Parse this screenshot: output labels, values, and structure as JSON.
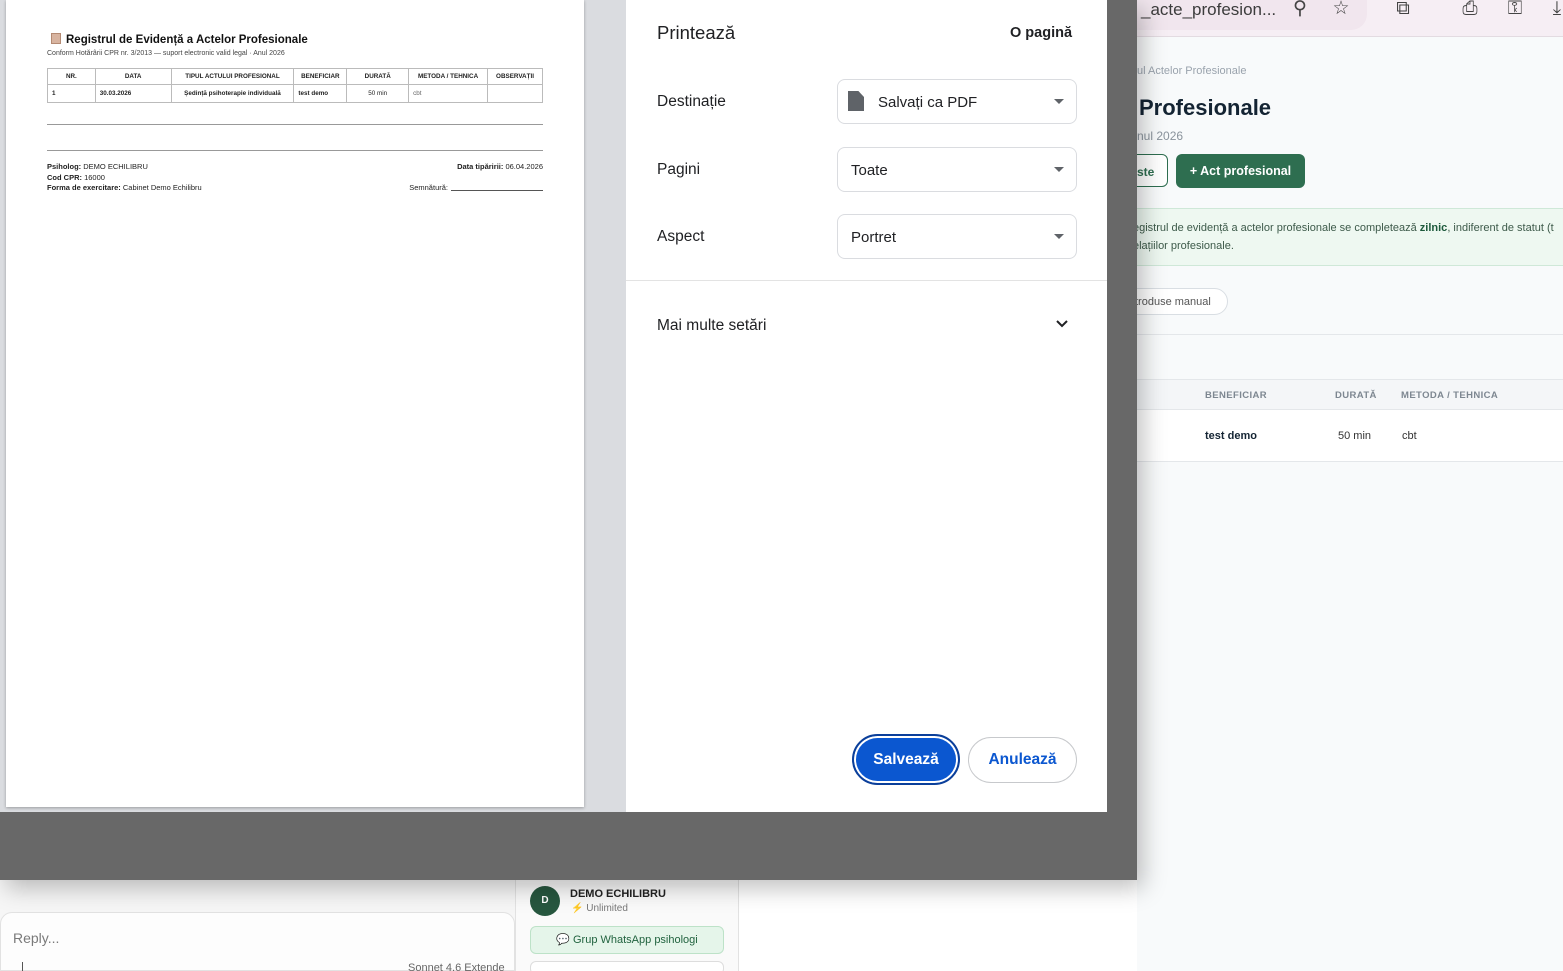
{
  "browser": {
    "omnibox_text": "_acte_profesion...",
    "icons": [
      "zoom-icon",
      "star-icon",
      "extensions-icon",
      "print-icon",
      "key-icon",
      "download-icon"
    ]
  },
  "app_page": {
    "breadcrumb": "ul Actelor Profesionale",
    "title": "Profesionale",
    "subtitle": "nul 2026",
    "btn_outline_label": "ste",
    "btn_primary_label": "+ Act profesional",
    "notice_prefix": "egistrul de evidență a actelor profesionale se completează ",
    "notice_bold": "zilnic",
    "notice_suffix": ", indiferent de statut (t",
    "notice_line2": "elațiilor profesionale.",
    "chip_label": "troduse manual",
    "table_headers": {
      "beneficiar": "BENEFICIAR",
      "durata": "DURATĂ",
      "metoda": "METODA / TEHNICA"
    },
    "row": {
      "beneficiar": "test demo",
      "durata": "50 min",
      "metoda": "cbt"
    }
  },
  "chat": {
    "reply_placeholder": "Reply...",
    "model_text": "Sonnet 4.6  Extende",
    "user_initial": "D",
    "user_name": "DEMO ECHILIBRU",
    "user_plan": "Unlimited",
    "whatsapp_label": "💬 Grup WhatsApp psihologi"
  },
  "preview": {
    "title": "Registrul de Evidență a Actelor Profesionale",
    "subtitle": "Conform Hotărârii CPR nr. 3/2013 — suport electronic valid legal · Anul 2026",
    "columns": [
      "NR.",
      "DATA",
      "TIPUL ACTULUI PROFESIONAL",
      "BENEFICIAR",
      "DURATĂ",
      "METODA / TEHNICA",
      "OBSERVAȚII"
    ],
    "rows": [
      {
        "nr": "1",
        "data": "30.03.2026",
        "tip": "Ședință psihoterapie individuală",
        "beneficiar": "test demo",
        "durata": "50 min",
        "metoda": "cbt",
        "observatii": ""
      }
    ],
    "psiholog_label": "Psiholog:",
    "psiholog_value": "DEMO ECHILIBRU",
    "cod_label": "Cod CPR:",
    "cod_value": "16000",
    "forma_label": "Forma de exercitare:",
    "forma_value": "Cabinet Demo Echilibru",
    "data_tiparire_label": "Data tipăririi:",
    "data_tiparire_value": "06.04.2026",
    "semnatura_label": "Semnătură:"
  },
  "print_dialog": {
    "title": "Printează",
    "page_count": "O pagină",
    "destination_label": "Destinație",
    "destination_value": "Salvați ca PDF",
    "pages_label": "Pagini",
    "pages_value": "Toate",
    "layout_label": "Aspect",
    "layout_value": "Portret",
    "more_settings_label": "Mai multe setări",
    "save_button": "Salvează",
    "cancel_button": "Anulează"
  }
}
